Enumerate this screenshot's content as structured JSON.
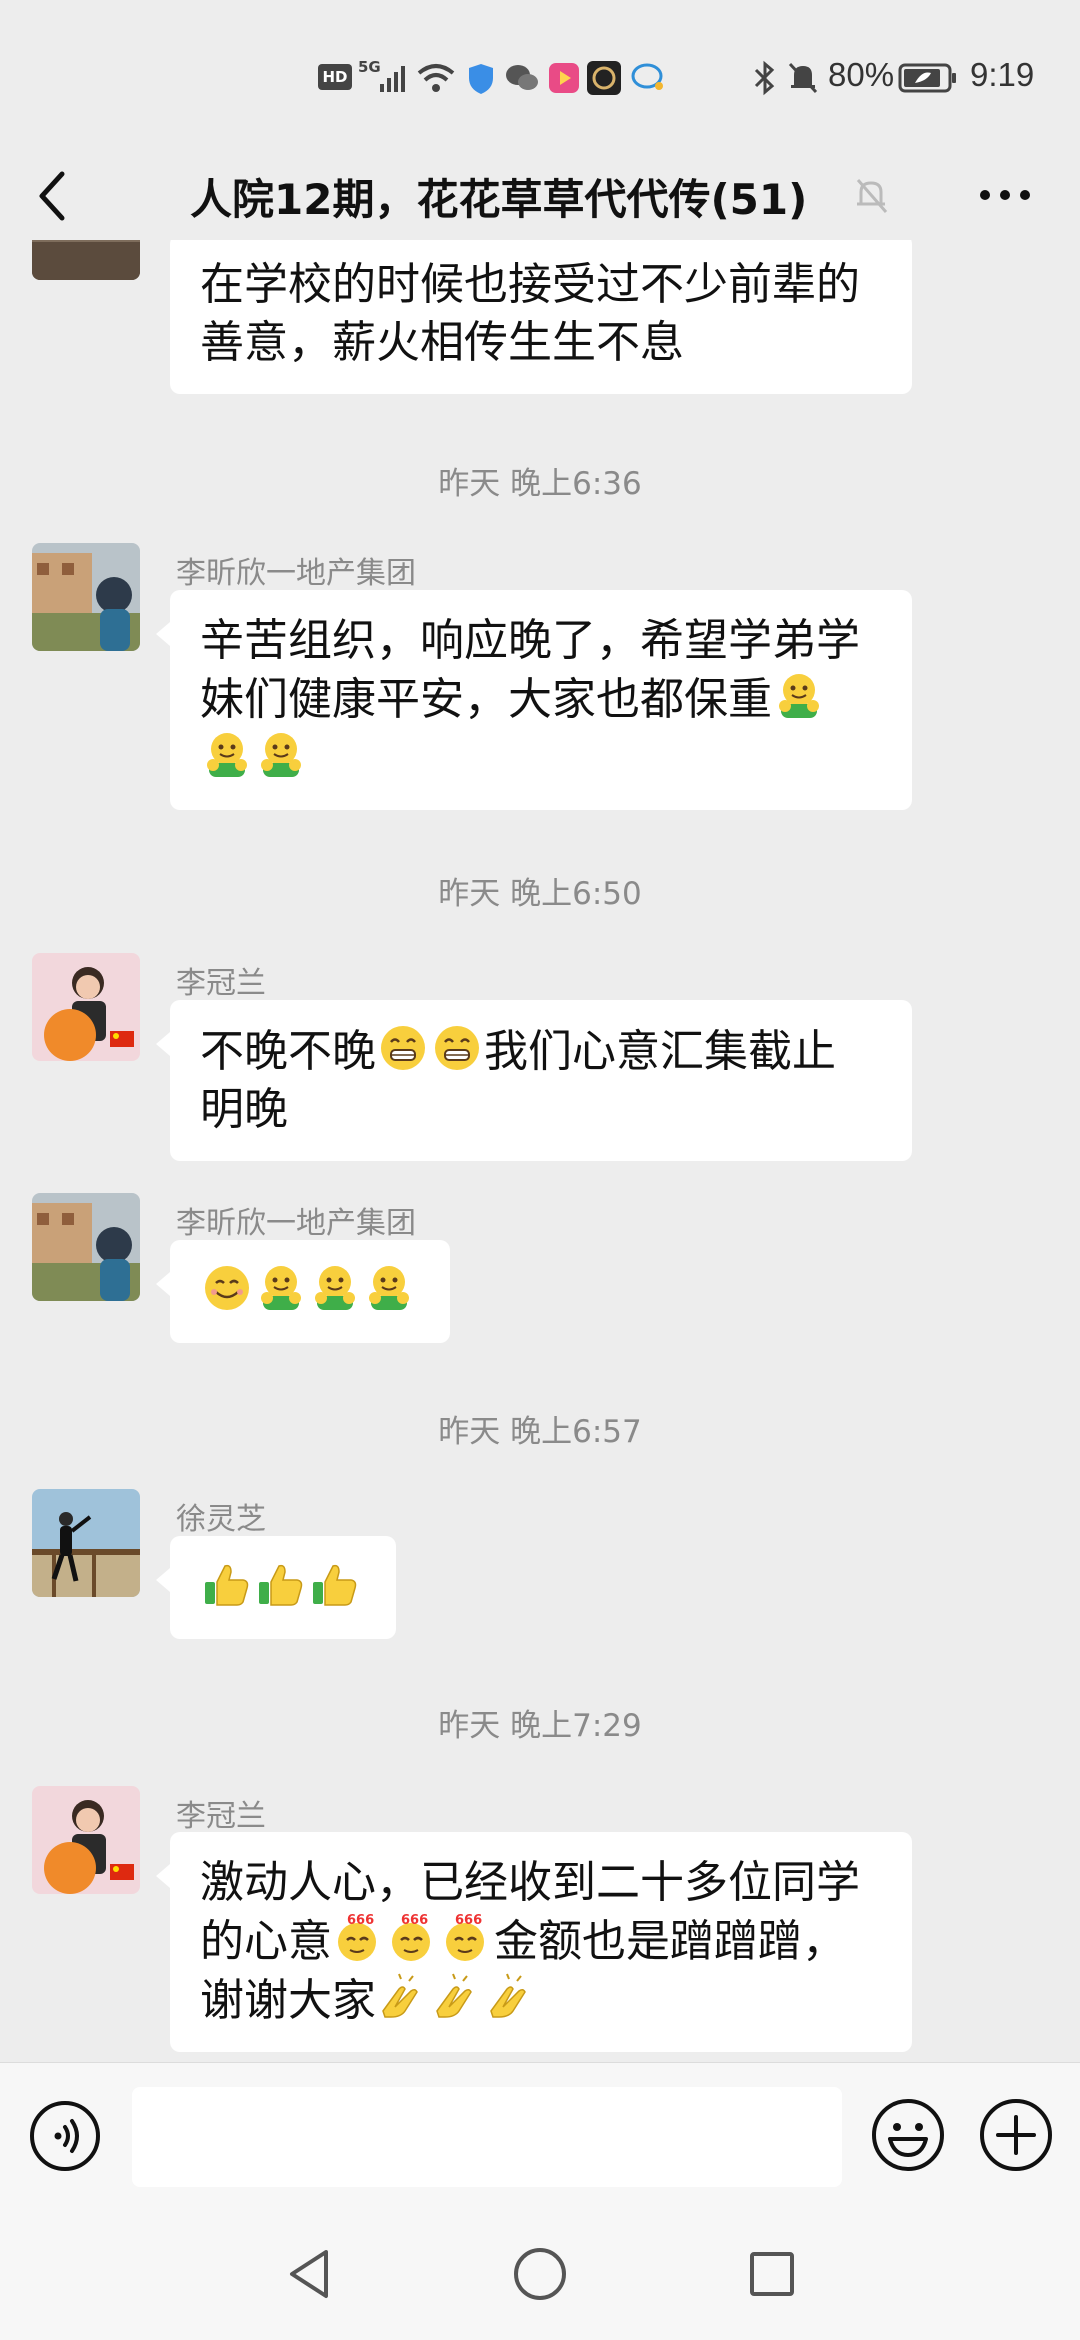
{
  "status_bar": {
    "hd": "HD",
    "network": "5G",
    "battery_percent": "80%",
    "time": "9:19"
  },
  "header": {
    "title": "人院12期，花花草草代代传(51)"
  },
  "messages": [
    {
      "text_lines": [
        "在学校的时候也接受过不少前辈的",
        "善意，薪火相传生生不息"
      ]
    },
    {
      "timestamp": "昨天 晚上6:36"
    },
    {
      "sender": "李昕欣一地产集团",
      "line1": "辛苦组织，响应晚了，希望学弟学",
      "line2": "妹们健康平安，大家也都保重",
      "emoji": "hug-emoji"
    },
    {
      "timestamp": "昨天 晚上6:50"
    },
    {
      "sender": "李冠兰",
      "line1_a": "不晚不晚",
      "line1_b": "我们心意汇集截止",
      "line2": "明晚",
      "emoji": "grin-emoji"
    },
    {
      "sender": "李昕欣一地产集团",
      "emoji": [
        "smile-emoji",
        "hug-emoji",
        "hug-emoji",
        "hug-emoji"
      ]
    },
    {
      "timestamp": "昨天 晚上6:57"
    },
    {
      "sender": "徐灵芝",
      "emoji": [
        "thumbs-up-emoji",
        "thumbs-up-emoji",
        "thumbs-up-emoji"
      ]
    },
    {
      "timestamp": "昨天 晚上7:29"
    },
    {
      "sender": "李冠兰",
      "line1": "激动人心，已经收到二十多位同学",
      "line2_a": "的心意",
      "line2_b": "金额也是蹭蹭蹭，",
      "line3": "谢谢大家",
      "emoji": [
        "666-emoji",
        "clap-emoji"
      ]
    }
  ],
  "colors": {
    "background": "#ededed",
    "bubble": "#ffffff",
    "meta_text": "#8a8a8a"
  }
}
